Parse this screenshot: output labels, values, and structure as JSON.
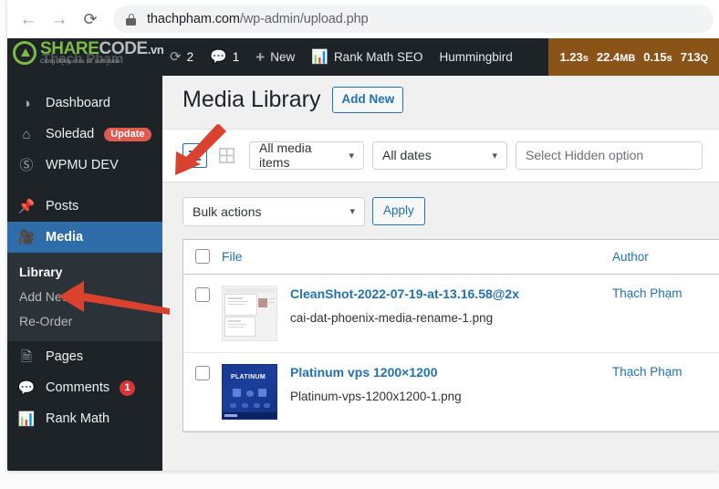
{
  "browser": {
    "back_icon": "back-arrow-icon",
    "forward_icon": "forward-arrow-icon",
    "reload_icon": "reload-icon",
    "lock_icon": "lock-icon",
    "url_host": "thachpham.com",
    "url_path": "/wp-admin/upload.php",
    "url_full": "thachpham.com/wp-admin/upload.php"
  },
  "watermark": {
    "brand_a": "SHARE",
    "brand_b": "CODE",
    "brand_c": ".vn",
    "tagline": "Cộng đồng chia sẻ soft code",
    "ghost_text": "Thạch Phạm"
  },
  "adminbar": {
    "updates_icon": "updates-icon",
    "updates_count": "2",
    "comments_icon": "comment-bubble-icon",
    "comments_count": "1",
    "new_icon": "plus-icon",
    "new_label": "New",
    "rankmath_icon": "rank-math-icon",
    "rankmath_label": "Rank Math SEO",
    "hummingbird_label": "Hummingbird",
    "perf": {
      "time": "1.23",
      "time_unit": "s",
      "memory": "22.4",
      "memory_unit": "MB",
      "db_time": "0.15",
      "db_time_unit": "s",
      "queries": "713",
      "queries_unit": "Q"
    }
  },
  "sidebar": {
    "items": [
      {
        "label": "Dashboard",
        "icon": "dashboard-icon",
        "badge": ""
      },
      {
        "label": "Soledad",
        "icon": "home-icon",
        "badge": "Update"
      },
      {
        "label": "WPMU DEV",
        "icon": "wpmu-dev-icon",
        "badge": ""
      },
      {
        "label": "Posts",
        "icon": "pin-icon",
        "badge": ""
      },
      {
        "label": "Media",
        "icon": "media-icon",
        "badge": "",
        "current": true
      },
      {
        "label": "Pages",
        "icon": "pages-icon",
        "badge": ""
      },
      {
        "label": "Comments",
        "icon": "comment-bubble-icon",
        "badge": "1"
      },
      {
        "label": "Rank Math",
        "icon": "rank-math-icon",
        "badge": ""
      }
    ],
    "submenu": [
      {
        "label": "Library",
        "current": true
      },
      {
        "label": "Add New",
        "current": false
      },
      {
        "label": "Re-Order",
        "current": false
      }
    ]
  },
  "page": {
    "title": "Media Library",
    "add_new_label": "Add New"
  },
  "filters": {
    "list_view_icon": "list-view-icon",
    "grid_view_icon": "grid-view-icon",
    "media_items": "All media items",
    "dates": "All dates",
    "hidden_option": "Select Hidden option",
    "caret_icon": "chevron-down-icon"
  },
  "tablenav": {
    "bulk_actions": "Bulk actions",
    "apply_label": "Apply",
    "caret_icon": "chevron-down-icon"
  },
  "table": {
    "columns": {
      "file": "File",
      "author": "Author"
    },
    "rows": [
      {
        "title": "CleanShot-2022-07-19-at-13.16.58@2x",
        "filename": "cai-dat-phoenix-media-rename-1.png",
        "author": "Thạch Phạm",
        "thumb": "screenshot-thumbnail"
      },
      {
        "title": "Platinum vps 1200×1200",
        "filename": "Platinum-vps-1200x1200-1.png",
        "author": "Thạch Phạm",
        "thumb": "platinum-vps-thumbnail",
        "thumb_logo": "PLATINUM"
      }
    ]
  },
  "annotations": [
    {
      "name": "arrow-to-list-view",
      "color": "#d9422e"
    },
    {
      "name": "arrow-to-library",
      "color": "#d9422e"
    }
  ]
}
